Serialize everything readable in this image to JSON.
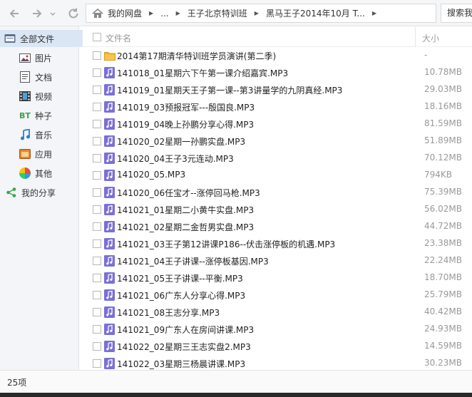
{
  "breadcrumb": {
    "items": [
      "我的网盘",
      "...",
      "王子北京特训班",
      "黑马王子2014年10月 T..."
    ]
  },
  "search": {
    "label": "搜索我"
  },
  "sidebar": {
    "items": [
      {
        "label": "全部文件",
        "icon": "folder-icon"
      },
      {
        "label": "图片",
        "icon": "image-icon"
      },
      {
        "label": "文档",
        "icon": "document-icon"
      },
      {
        "label": "视频",
        "icon": "video-icon"
      },
      {
        "label": "种子",
        "icon": "bt-icon",
        "icon_text": "BT"
      },
      {
        "label": "音乐",
        "icon": "music-icon"
      },
      {
        "label": "应用",
        "icon": "app-icon"
      },
      {
        "label": "其他",
        "icon": "other-icon"
      },
      {
        "label": "我的分享",
        "icon": "share-icon"
      }
    ]
  },
  "header": {
    "name_label": "文件名",
    "size_label": "大小"
  },
  "files": [
    {
      "name": "2014第17期清华特训班学员演讲(第二季)",
      "size": "-",
      "type": "folder"
    },
    {
      "name": "141018_01星期六下午第一课介绍嘉宾.MP3",
      "size": "10.78MB",
      "type": "audio"
    },
    {
      "name": "141019_01星期天王子第一课--第3讲量学的九阴真经.MP3",
      "size": "29.03MB",
      "type": "audio"
    },
    {
      "name": "141019_03预报冠军---殷国良.MP3",
      "size": "18.16MB",
      "type": "audio"
    },
    {
      "name": "141019_04晚上孙鹏分享心得.MP3",
      "size": "81.59MB",
      "type": "audio"
    },
    {
      "name": "141020_02星期一孙鹏实盘.MP3",
      "size": "51.89MB",
      "type": "audio"
    },
    {
      "name": "141020_04王子3元连动.MP3",
      "size": "70.12MB",
      "type": "audio"
    },
    {
      "name": "141020_05.MP3",
      "size": "794KB",
      "type": "audio"
    },
    {
      "name": "141020_06任宝才--涨停回马枪.MP3",
      "size": "75.39MB",
      "type": "audio"
    },
    {
      "name": "141021_01星期二小黄牛实盘.MP3",
      "size": "56.02MB",
      "type": "audio"
    },
    {
      "name": "141021_02星期二金哲男实盘.MP3",
      "size": "44.72MB",
      "type": "audio"
    },
    {
      "name": "141021_03王子第12讲课P186--伏击涨停板的机遇.MP3",
      "size": "23.38MB",
      "type": "audio"
    },
    {
      "name": "141021_04王子讲课--涨停板基因.MP3",
      "size": "22.24MB",
      "type": "audio"
    },
    {
      "name": "141021_05王子讲课--平衡.MP3",
      "size": "18.70MB",
      "type": "audio"
    },
    {
      "name": "141021_06广东人分享心得.MP3",
      "size": "25.79MB",
      "type": "audio"
    },
    {
      "name": "141021_08王志分享.MP3",
      "size": "40.42MB",
      "type": "audio"
    },
    {
      "name": "141021_09广东人在房间讲课.MP3",
      "size": "24.93MB",
      "type": "audio"
    },
    {
      "name": "141022_02星期三王志实盘2.MP3",
      "size": "14.59MB",
      "type": "audio"
    },
    {
      "name": "141022_03星期三杨晨讲课.MP3",
      "size": "30.23MB",
      "type": "audio"
    }
  ],
  "status": {
    "count": "25项"
  },
  "colors": {
    "accent": "#dbe6f5",
    "audio_icon": "#7b6fd6",
    "folder": "#f3b32c"
  }
}
